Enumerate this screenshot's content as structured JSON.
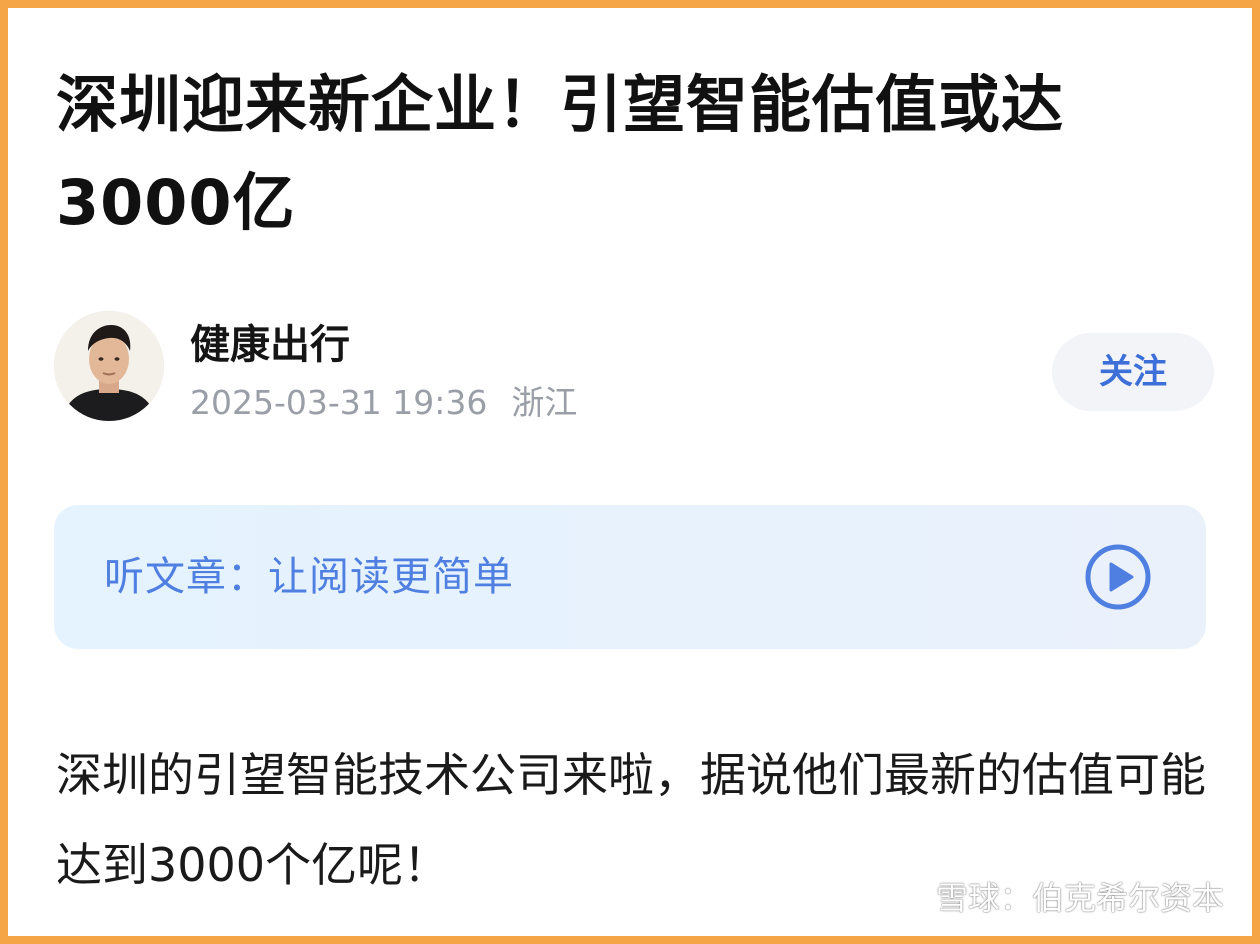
{
  "article": {
    "title": "深圳迎来新企业！引望智能估值或达3000亿",
    "author": {
      "name": "健康出行",
      "timestamp": "2025-03-31 19:36",
      "location": "浙江",
      "avatar_icon": "person-avatar"
    },
    "follow_label": "关注",
    "listen": {
      "label": "听文章：让阅读更简单",
      "icon": "play-circle-icon"
    },
    "body": "深圳的引望智能技术公司来啦，据说他们最新的估值可能达到3000个亿呢！"
  },
  "watermark": {
    "text": "雪球：伯克希尔资本",
    "icon": "snowball-logo-icon"
  },
  "colors": {
    "frame": "#f5a446",
    "accent": "#3d6fd8",
    "listen_text": "#4f7fe0",
    "meta_text": "#9a9ea6"
  }
}
